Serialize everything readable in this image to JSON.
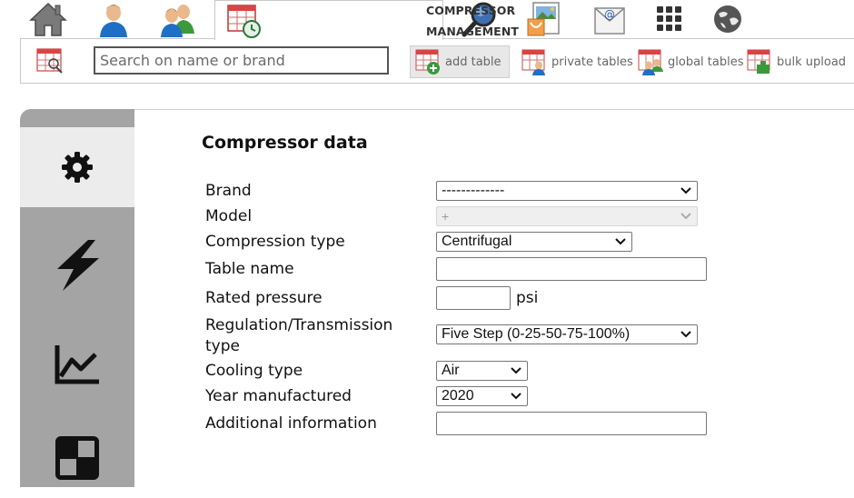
{
  "top_tabs": [
    {
      "icon": "home-icon"
    },
    {
      "icon": "user-icon"
    },
    {
      "icon": "users-icon"
    },
    {
      "icon": "compressor-table-icon",
      "label": "COMPRESSOR MANAGEMENT",
      "active": true
    },
    {
      "icon": "magnifier-icon"
    },
    {
      "icon": "document-image-icon"
    },
    {
      "icon": "mail-icon"
    },
    {
      "icon": "apps-grid-icon"
    },
    {
      "icon": "globe-icon"
    }
  ],
  "toolbar": {
    "search_placeholder": "Search on name or brand",
    "add_table": "add table",
    "private_tables": "private tables",
    "global_tables": "global tables",
    "bulk_upload": "bulk upload"
  },
  "rail": {
    "items": [
      {
        "icon": "gear-icon",
        "active": true
      },
      {
        "icon": "lightning-icon"
      },
      {
        "icon": "line-chart-icon"
      },
      {
        "icon": "quadrant-icon"
      }
    ]
  },
  "form": {
    "title": "Compressor data",
    "brand": {
      "label": "Brand",
      "value": "-------------"
    },
    "model": {
      "label": "Model",
      "value": "+"
    },
    "compression_type": {
      "label": "Compression type",
      "value": "Centrifugal"
    },
    "table_name": {
      "label": "Table name",
      "value": ""
    },
    "rated_pressure": {
      "label": "Rated pressure",
      "value": "",
      "unit": "psi"
    },
    "regulation": {
      "label_line1": "Regulation/Transmission",
      "label_line2": "type",
      "value": "Five Step (0-25-50-75-100%)"
    },
    "cooling_type": {
      "label": "Cooling type",
      "value": "Air"
    },
    "year_manufactured": {
      "label": "Year manufactured",
      "value": "2020"
    },
    "additional_information": {
      "label": "Additional information",
      "value": ""
    }
  },
  "colors": {
    "rail_bg": "#a4a4a4",
    "rail_active": "#ececec",
    "add_button_bg": "#e8e8e8"
  }
}
